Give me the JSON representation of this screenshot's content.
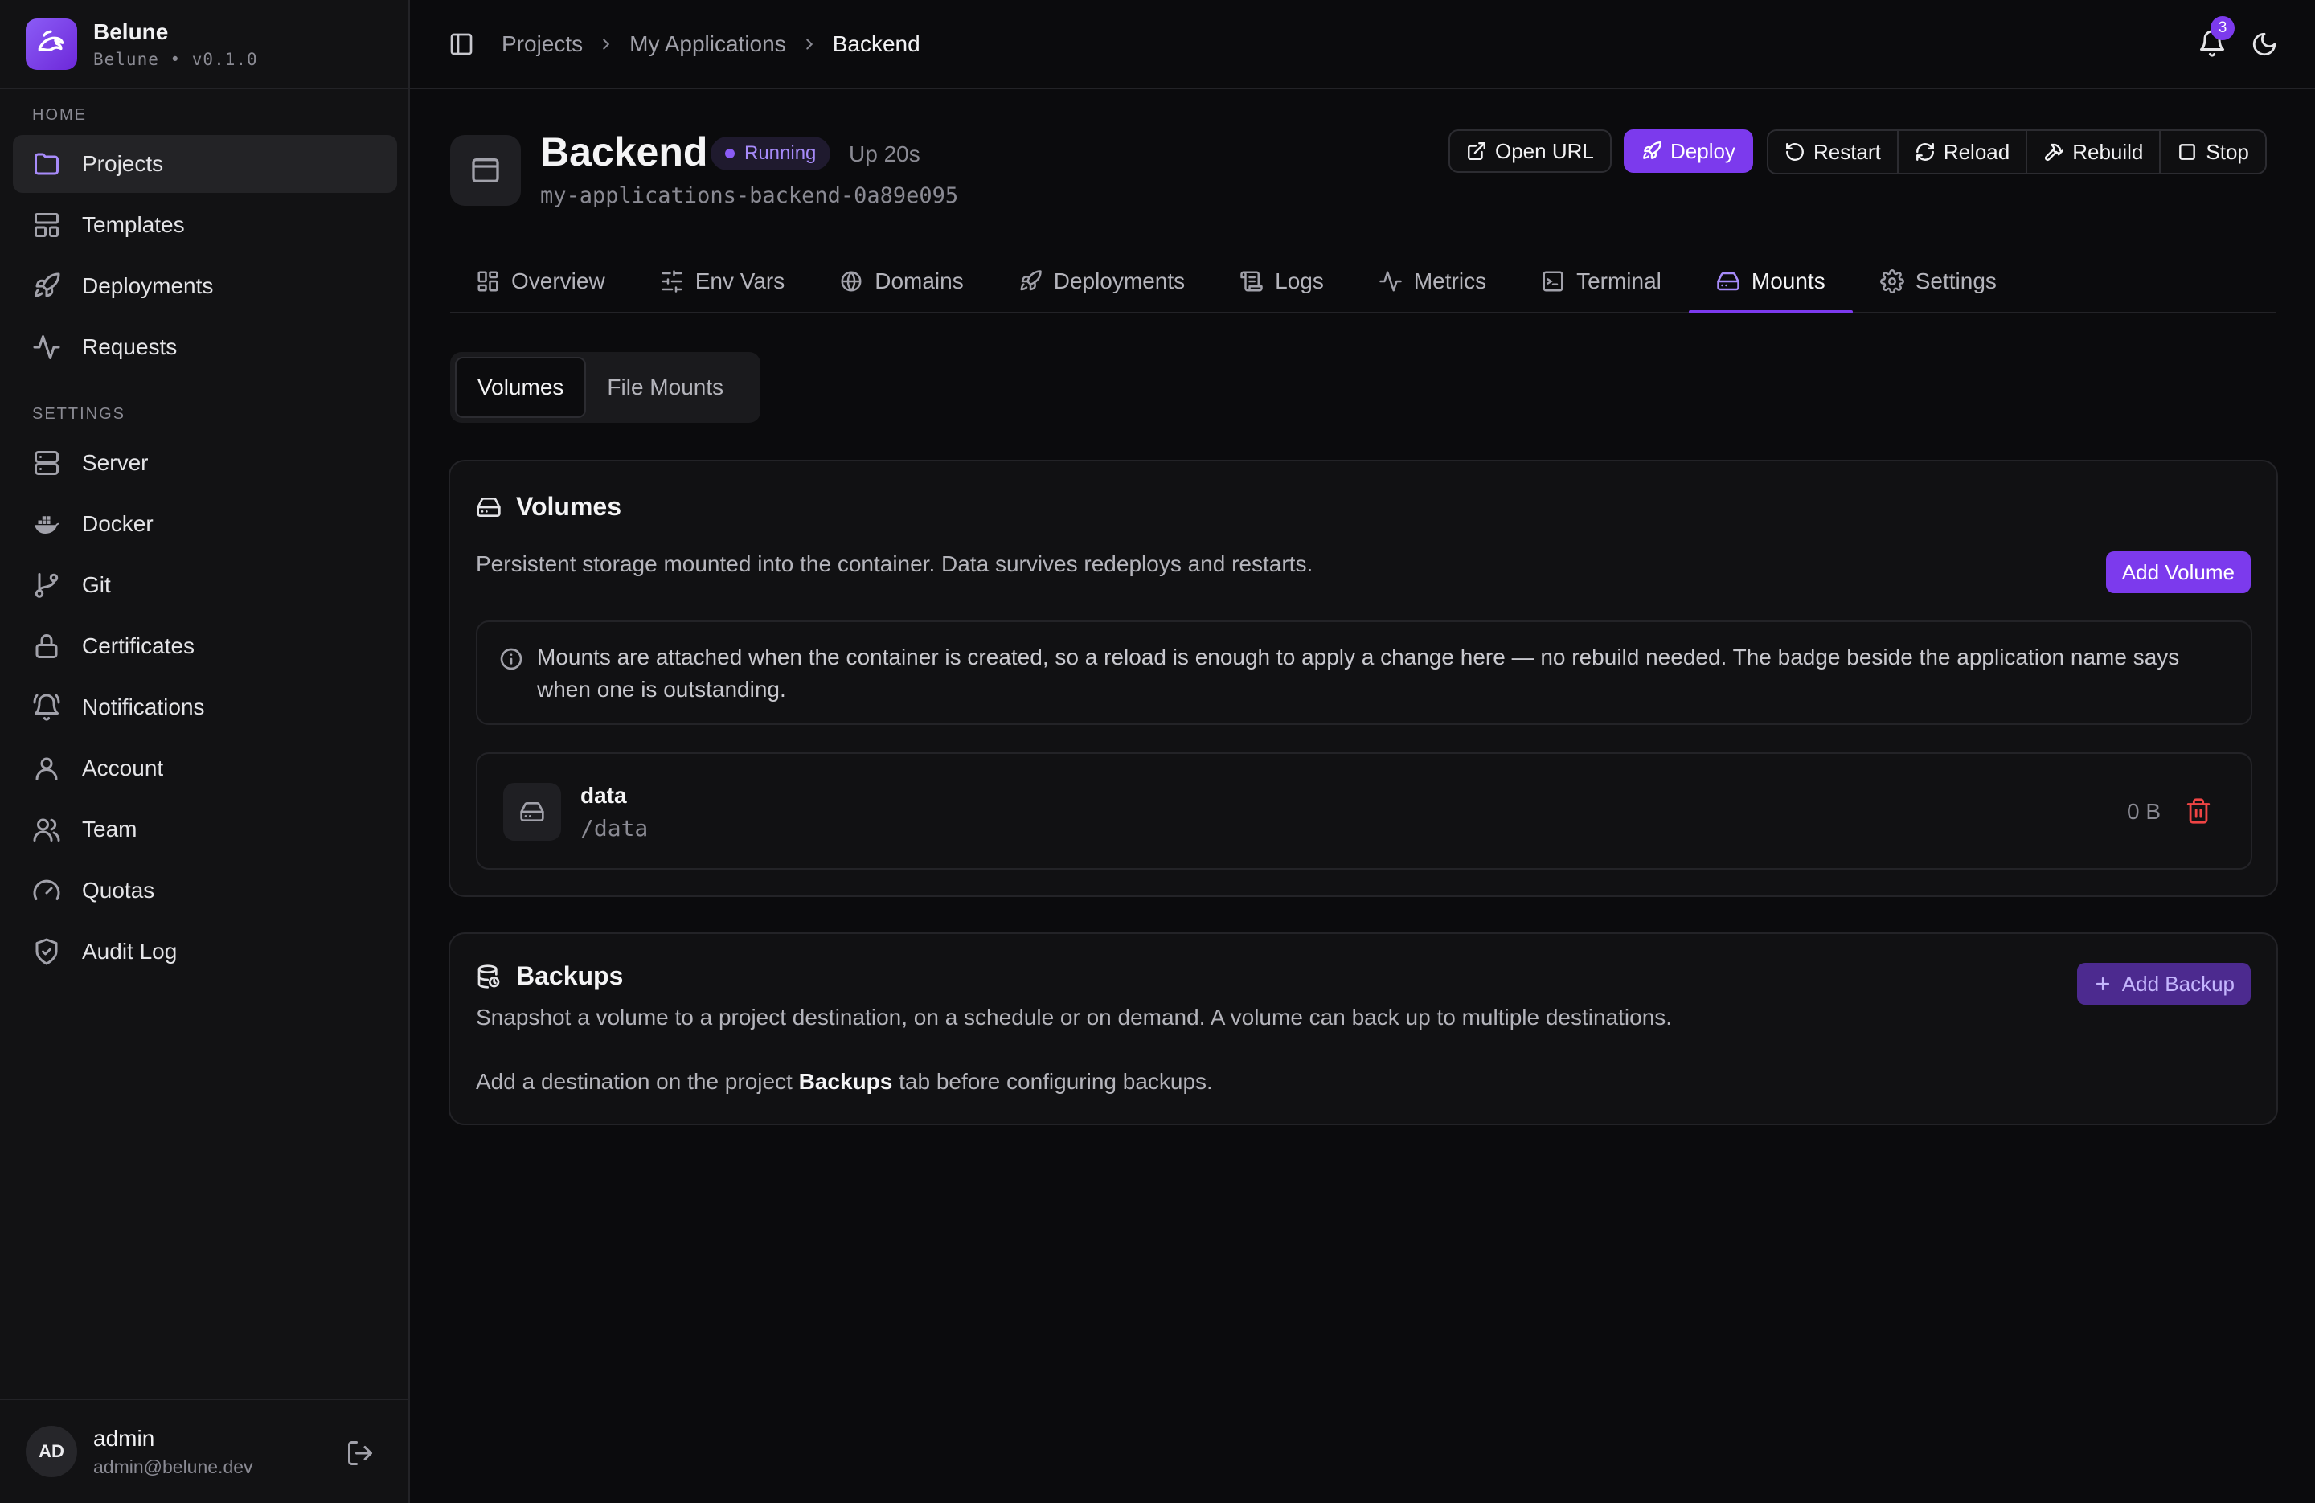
{
  "brand": {
    "name": "Belune",
    "subtitle": "Belune • v0.1.0"
  },
  "sidebar": {
    "home_label": "HOME",
    "settings_label": "SETTINGS",
    "home_items": [
      {
        "label": "Projects",
        "icon": "folder-icon",
        "active": true
      },
      {
        "label": "Templates",
        "icon": "layout-icon"
      },
      {
        "label": "Deployments",
        "icon": "rocket-icon"
      },
      {
        "label": "Requests",
        "icon": "activity-icon"
      }
    ],
    "settings_items": [
      {
        "label": "Server",
        "icon": "server-icon"
      },
      {
        "label": "Docker",
        "icon": "docker-icon"
      },
      {
        "label": "Git",
        "icon": "git-branch-icon"
      },
      {
        "label": "Certificates",
        "icon": "lock-icon"
      },
      {
        "label": "Notifications",
        "icon": "bell-icon"
      },
      {
        "label": "Account",
        "icon": "user-icon"
      },
      {
        "label": "Team",
        "icon": "users-icon"
      },
      {
        "label": "Quotas",
        "icon": "gauge-icon"
      },
      {
        "label": "Audit Log",
        "icon": "shield-icon"
      }
    ],
    "user": {
      "initials": "AD",
      "name": "admin",
      "email": "admin@belune.dev"
    }
  },
  "topbar": {
    "breadcrumbs": [
      "Projects",
      "My Applications",
      "Backend"
    ],
    "notification_count": "3"
  },
  "app": {
    "title": "Backend",
    "status": "Running",
    "uptime": "Up 20s",
    "container": "my-applications-backend-0a89e095",
    "accent": "#7c3aed"
  },
  "actions": {
    "open_url": "Open URL",
    "deploy": "Deploy",
    "restart": "Restart",
    "reload": "Reload",
    "rebuild": "Rebuild",
    "stop": "Stop"
  },
  "tabs": [
    {
      "label": "Overview",
      "icon": "grid-icon"
    },
    {
      "label": "Env Vars",
      "icon": "sliders-icon"
    },
    {
      "label": "Domains",
      "icon": "globe-icon"
    },
    {
      "label": "Deployments",
      "icon": "rocket-icon"
    },
    {
      "label": "Logs",
      "icon": "scroll-icon"
    },
    {
      "label": "Metrics",
      "icon": "activity-icon"
    },
    {
      "label": "Terminal",
      "icon": "terminal-icon"
    },
    {
      "label": "Mounts",
      "icon": "hard-drive-icon",
      "active": true
    },
    {
      "label": "Settings",
      "icon": "gear-icon"
    }
  ],
  "subtabs": {
    "volumes": "Volumes",
    "file_mounts": "File Mounts"
  },
  "volumes_card": {
    "title": "Volumes",
    "description": "Persistent storage mounted into the container. Data survives redeploys and restarts.",
    "add_button": "Add Volume",
    "info": "Mounts are attached when the container is created, so a reload is enough to apply a change here — no rebuild needed. The badge beside the application name says when one is outstanding.",
    "items": [
      {
        "name": "data",
        "path": "/data",
        "size": "0 B"
      }
    ]
  },
  "backups_card": {
    "title": "Backups",
    "description": "Snapshot a volume to a project destination, on a schedule or on demand. A volume can back up to multiple destinations.",
    "add_button": "Add Backup",
    "hint_prefix": "Add a destination on the project ",
    "hint_strong": "Backups",
    "hint_suffix": " tab before configuring backups."
  }
}
